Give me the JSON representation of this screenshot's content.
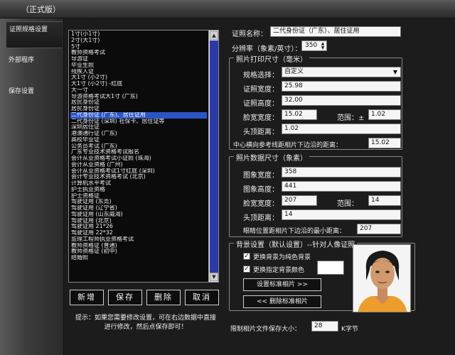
{
  "window": {
    "title": "（正式版）"
  },
  "tabs": [
    {
      "label": "证照规格设置"
    },
    {
      "label": "外部程序"
    },
    {
      "label": "保存设置"
    }
  ],
  "list": {
    "items": [
      "1寸(小1寸)",
      "2寸(大1寸)",
      "5寸",
      "教师资格考试",
      "导游证",
      "毕业生照",
      "残疾人证",
      "大1寸 (小2寸)",
      "大1寸 (小2寸) -红底",
      "大一寸",
      "导游资格考试大1寸 (广东)",
      "居民身份证",
      "居民身份证",
      "二代身份证 (广东)、居住证用",
      "二代身份证 (深圳) 社保卡、居住证等",
      "深圳居住证",
      "港澳通行证 (广东)",
      "高校毕业证",
      "公务员考试 (广东)",
      "广东专业技术资格考试报名",
      "会计从业资格考试小证照 (珠海)",
      "会计从业资格 (广州)",
      "会计从业资格考试1寸红底 (深圳)",
      "会计专业技术资格考试 (北京)",
      "计算机水平考试",
      "护士执业资格",
      "护士资格证",
      "驾驶证用 (东莞)",
      "驾驶证用 (辽宁省)",
      "驾驶证用 (山东威海)",
      "驾驶证用 (北京)",
      "驾驶证用 21*26",
      "驾驶证用 22*32",
      "监理工程师执业资格考试",
      "教师资格证 (普通)",
      "教师资格证 (初中)",
      "结婚照"
    ],
    "selected_index": 13
  },
  "buttons": {
    "new": "新增",
    "save": "保存",
    "delete": "删除",
    "cancel": "取消"
  },
  "hint": "提示：如果您需要修改设置，可在右边数据中直接进行修改，然后点保存即可！",
  "form": {
    "spec_name_label": "证照名称：",
    "spec_name_value": "二代身份证（广东）、居住证用",
    "dpi_label": "分辨率（象素/英寸）：",
    "dpi_value": "350",
    "print_group_title": "照片打印尺寸（毫米）",
    "spec_select_label": "规格选择：",
    "spec_select_value": "自定义",
    "photo_width_label": "证照宽度：",
    "photo_width_value": "25.98",
    "photo_height_label": "证照高度：",
    "photo_height_value": "32.00",
    "face_width_label": "脸宽宽度：",
    "face_width_value": "15.02",
    "range_label": "范围：±",
    "range_value": "1.02",
    "head_top_label": "头顶距离：",
    "head_top_value": "1.02",
    "center_dist_label": "中心横向参考线距相片下边沿的距离：",
    "center_dist_value": "15.02",
    "pixel_group_title": "照片数据尺寸（象素）",
    "img_width_label": "图象宽度：",
    "img_width_value": "358",
    "img_height_label": "图象高度：",
    "img_height_value": "441",
    "face_px_label": "脸宽宽度：",
    "face_px_value": "207",
    "range_px_label": "范围：",
    "range_px_value": "14",
    "head_top_px_label": "头顶距离：",
    "head_top_px_value": "14",
    "eye_pos_label": "眼睛位置距相片下边沿的最小距离：",
    "eye_pos_value": "207",
    "bg_group_title": "背景设置（默认设置）--针对人像证照",
    "bg_check1_label": "更换背景为纯色背景",
    "bg_check2_label": "更换指定背景颜色",
    "set_std_photo_btn": "设置标准相片 >>",
    "del_std_photo_btn": "<< 删除标准相片",
    "file_size_label": "限制相片文件保存大小：",
    "file_size_value": "28",
    "file_size_unit": "K字节"
  },
  "colors": {
    "selection": "#2b55c6",
    "scroll_thumb": "#2b3aa8",
    "photo_bg": "#f4f4f4",
    "shirt": "#ee9d2a"
  }
}
